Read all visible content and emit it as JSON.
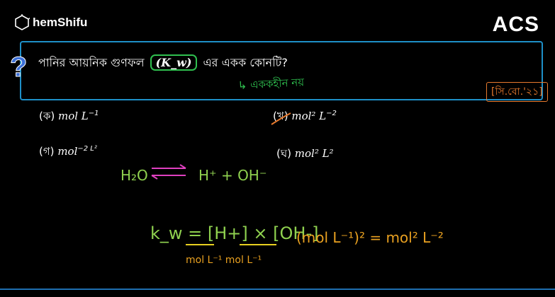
{
  "brand": {
    "name": "hemShifu",
    "right_logo": "ACS"
  },
  "question": {
    "text_before": "পানির আয়নিক গুণফল",
    "kw_label": "(K_w)",
    "text_after": "এর একক কোনটি?",
    "board_tag": "[সি.বো.'২১]",
    "annotation": "↳ এককহীন নয়"
  },
  "options": [
    {
      "label": "(ক)",
      "expr": "mol L",
      "sup": "−1"
    },
    {
      "label": "(খ)",
      "expr": "mol² L",
      "sup": "−2",
      "marked": true
    },
    {
      "label": "(গ)",
      "expr": "mol",
      "sup": "−2 L²"
    },
    {
      "label": "(ঘ)",
      "expr": "mol² L²",
      "sup": ""
    }
  ],
  "handwriting": {
    "equilibrium": "H₂O ⇌ H⁺ + OH⁻",
    "kw_expr": "k_w = [H+] × [OH-]",
    "units": "mol L⁻¹   mol L⁻¹",
    "result": "(mol L⁻¹)² = mol² L⁻²"
  },
  "colors": {
    "accent_blue": "#1e90c8",
    "green": "#2fbf4f",
    "orange": "#e87a2d",
    "magenta": "#e040c0",
    "yellow": "#e8d020"
  }
}
